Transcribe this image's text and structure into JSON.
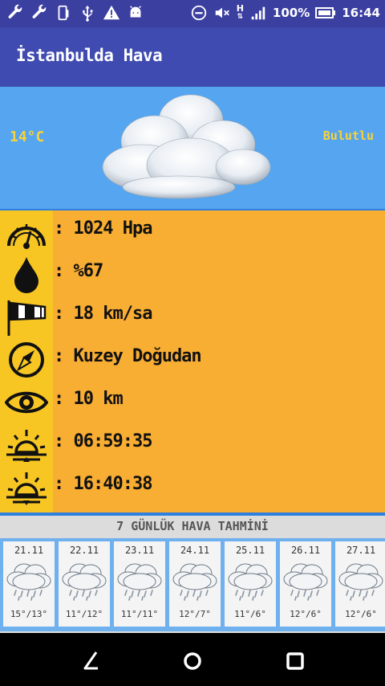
{
  "status_bar": {
    "left_icons": [
      "wrench-icon",
      "wrench-icon",
      "phone-portrait-icon",
      "usb-icon",
      "warning-icon",
      "android-icon"
    ],
    "right_icons": [
      "do-not-disturb-icon",
      "mute-icon",
      "network-h-icon",
      "signal-icon"
    ],
    "network_label": "H",
    "battery": "100%",
    "time": "16:44"
  },
  "app_bar": {
    "title": "İstanbulda Hava"
  },
  "current": {
    "temperature": "14°C",
    "condition": "Bulutlu",
    "icon": "cloud-icon"
  },
  "details": [
    {
      "icon": "barometer-icon",
      "value": ": 1024 Hpa"
    },
    {
      "icon": "humidity-drop-icon",
      "value": ": %67"
    },
    {
      "icon": "windsock-icon",
      "value": ": 18 km/sa"
    },
    {
      "icon": "compass-icon",
      "value": ": Kuzey Doğudan"
    },
    {
      "icon": "visibility-eye-icon",
      "value": ": 10 km"
    },
    {
      "icon": "sunrise-icon",
      "value": ": 06:59:35"
    },
    {
      "icon": "sunset-icon",
      "value": ": 16:40:38"
    }
  ],
  "forecast": {
    "header": "7 GÜNLÜK HAVA TAHMİNİ",
    "days": [
      {
        "date": "21.11",
        "temps": "15°/13°",
        "icon": "rain-cloud-icon"
      },
      {
        "date": "22.11",
        "temps": "11°/12°",
        "icon": "rain-cloud-icon"
      },
      {
        "date": "23.11",
        "temps": "11°/11°",
        "icon": "rain-cloud-icon"
      },
      {
        "date": "24.11",
        "temps": "12°/7°",
        "icon": "rain-cloud-icon"
      },
      {
        "date": "25.11",
        "temps": "11°/6°",
        "icon": "rain-cloud-icon"
      },
      {
        "date": "26.11",
        "temps": "12°/6°",
        "icon": "rain-cloud-icon"
      },
      {
        "date": "27.11",
        "temps": "12°/6°",
        "icon": "rain-cloud-icon"
      }
    ]
  },
  "nav_bar": {
    "buttons": [
      "back-button",
      "home-button",
      "recents-button"
    ]
  },
  "colors": {
    "status_bar": "#3b3fa0",
    "app_bar": "#3f4bb1",
    "current_bg": "#55a5f0",
    "accent_text": "#f8d23a",
    "details_bg": "#f8ad33",
    "icon_column": "#f7c623",
    "forecast_bg": "#dcdcdc"
  }
}
